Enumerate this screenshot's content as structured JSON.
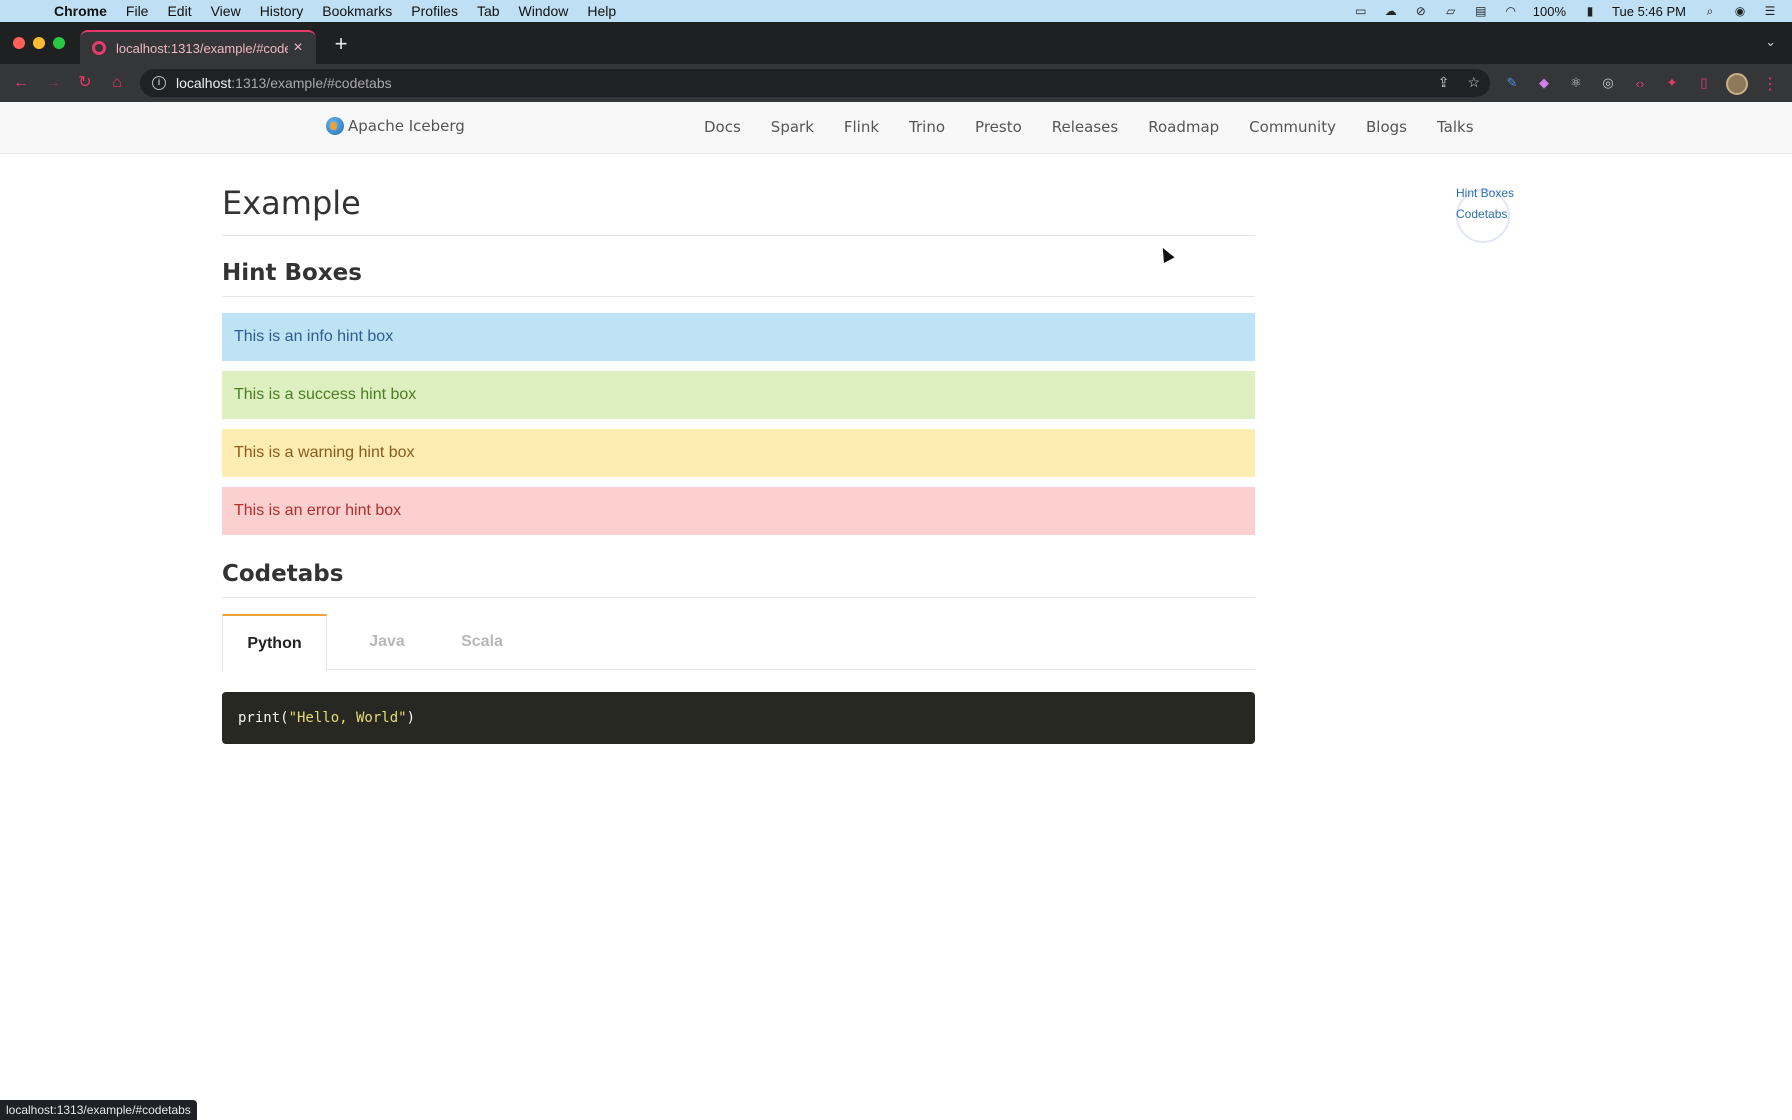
{
  "mac_menubar": {
    "app_name": "Chrome",
    "menus": [
      "File",
      "Edit",
      "View",
      "History",
      "Bookmarks",
      "Profiles",
      "Tab",
      "Window",
      "Help"
    ],
    "battery": "100%",
    "clock": "Tue 5:46 PM"
  },
  "browser": {
    "tab_title": "localhost:1313/example/#codetabs",
    "url_host": "localhost",
    "url_path": ":1313/example/#codetabs",
    "accent_color": "#e8396c",
    "status_url": "localhost:1313/example/#codetabs"
  },
  "site": {
    "brand": "Apache Iceberg",
    "nav_links": [
      "Docs",
      "Spark",
      "Flink",
      "Trino",
      "Presto",
      "Releases",
      "Roadmap",
      "Community",
      "Blogs",
      "Talks"
    ]
  },
  "page": {
    "title": "Example",
    "hint_section_title": "Hint Boxes",
    "hints": {
      "info": "This is an info hint box",
      "success": "This is a success hint box",
      "warning": "This is a warning hint box",
      "error": "This is an error hint box"
    },
    "codetabs_title": "Codetabs",
    "code_tabs": [
      "Python",
      "Java",
      "Scala"
    ],
    "active_tab": "Python",
    "code": {
      "fn": "print(",
      "str": "\"Hello, World\"",
      "close": ")"
    }
  },
  "toc": {
    "items": [
      "Hint Boxes",
      "Codetabs"
    ]
  }
}
